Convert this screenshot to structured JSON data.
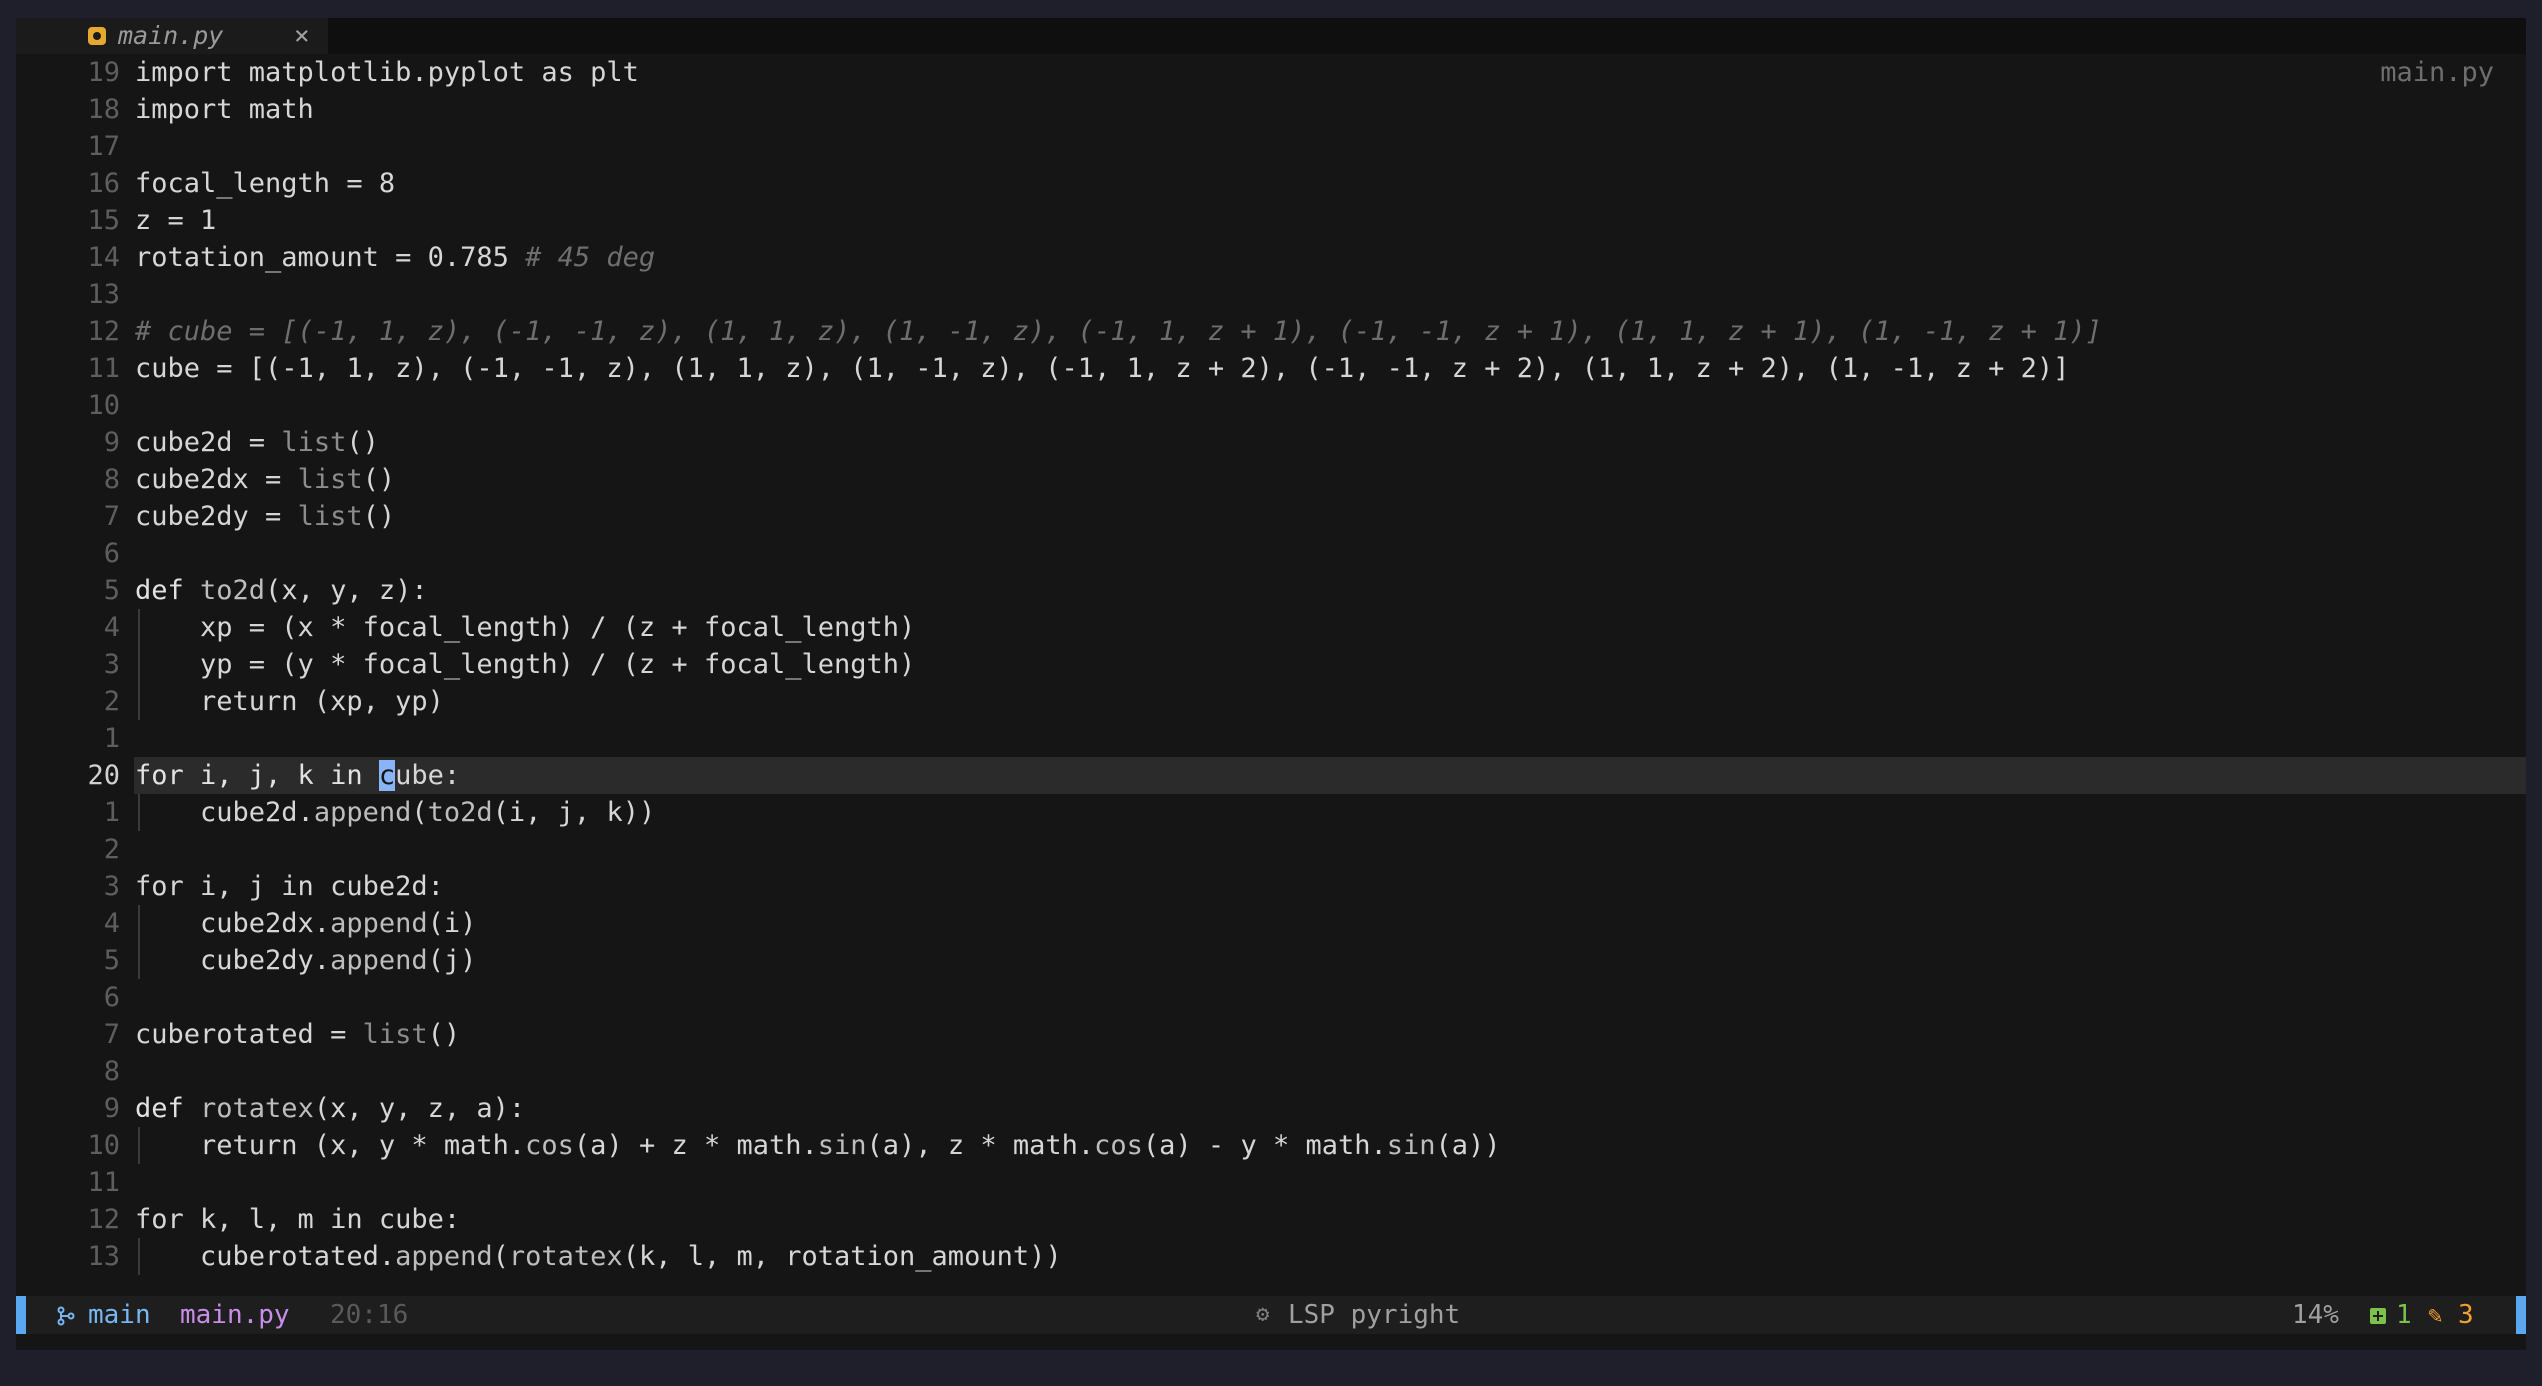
{
  "tab": {
    "label": "main.py",
    "close": "×"
  },
  "file_badge": "main.py",
  "lines": [
    {
      "num": "19",
      "segments": [
        {
          "t": "import matplotlib.pyplot as plt",
          "c": ""
        }
      ]
    },
    {
      "num": "18",
      "segments": [
        {
          "t": "import math",
          "c": ""
        }
      ]
    },
    {
      "num": "17",
      "segments": []
    },
    {
      "num": "16",
      "segments": [
        {
          "t": "focal_length = 8",
          "c": ""
        }
      ]
    },
    {
      "num": "15",
      "segments": [
        {
          "t": "z = 1",
          "c": ""
        }
      ]
    },
    {
      "num": "14",
      "segments": [
        {
          "t": "rotation_amount = 0.785 ",
          "c": ""
        },
        {
          "t": "# 45 deg",
          "c": "cm"
        }
      ]
    },
    {
      "num": "13",
      "segments": []
    },
    {
      "num": "12",
      "segments": [
        {
          "t": "# cube = [(-1, 1, z), (-1, -1, z), (1, 1, z), (1, -1, z), (-1, 1, z + 1), (-1, -1, z + 1), (1, 1, z + 1), (1, -1, z + 1)]",
          "c": "cm"
        }
      ]
    },
    {
      "num": "11",
      "segments": [
        {
          "t": "cube = [(-1, 1, z), (-1, -1, z), (1, 1, z), (1, -1, z), (-1, 1, z + 2), (-1, -1, z + 2), (1, 1, z + 2), (1, -1, z + 2)]",
          "c": ""
        }
      ]
    },
    {
      "num": "10",
      "segments": []
    },
    {
      "num": "9",
      "segments": [
        {
          "t": "cube2d = ",
          "c": ""
        },
        {
          "t": "list",
          "c": "bi"
        },
        {
          "t": "()",
          "c": ""
        }
      ]
    },
    {
      "num": "8",
      "segments": [
        {
          "t": "cube2dx = ",
          "c": ""
        },
        {
          "t": "list",
          "c": "bi"
        },
        {
          "t": "()",
          "c": ""
        }
      ]
    },
    {
      "num": "7",
      "segments": [
        {
          "t": "cube2dy = ",
          "c": ""
        },
        {
          "t": "list",
          "c": "bi"
        },
        {
          "t": "()",
          "c": ""
        }
      ]
    },
    {
      "num": "6",
      "segments": []
    },
    {
      "num": "5",
      "segments": [
        {
          "t": "def ",
          "c": "kw"
        },
        {
          "t": "to2d",
          "c": "fn"
        },
        {
          "t": "(x, y, z):",
          "c": ""
        }
      ]
    },
    {
      "num": "4",
      "indent": true,
      "segments": [
        {
          "t": "    xp = (x * focal_length) / (z + focal_length)",
          "c": ""
        }
      ]
    },
    {
      "num": "3",
      "indent": true,
      "segments": [
        {
          "t": "    yp = (y * focal_length) / (z + focal_length)",
          "c": ""
        }
      ]
    },
    {
      "num": "2",
      "indent": true,
      "segments": [
        {
          "t": "    return (xp, yp)",
          "c": ""
        }
      ]
    },
    {
      "num": "1",
      "segments": []
    },
    {
      "num": "20",
      "current": true,
      "segments": [
        {
          "t": "for i, j, k in ",
          "c": "kw"
        },
        {
          "t": "c",
          "c": "cursor"
        },
        {
          "t": "ube:",
          "c": ""
        }
      ]
    },
    {
      "num": "1",
      "indent": true,
      "segments": [
        {
          "t": "    cube2d.",
          "c": ""
        },
        {
          "t": "append",
          "c": "fn"
        },
        {
          "t": "(",
          "c": ""
        },
        {
          "t": "to2d",
          "c": "fn"
        },
        {
          "t": "(i, j, k))",
          "c": ""
        }
      ]
    },
    {
      "num": "2",
      "segments": []
    },
    {
      "num": "3",
      "segments": [
        {
          "t": "for i, j in cube2d:",
          "c": ""
        }
      ]
    },
    {
      "num": "4",
      "indent": true,
      "segments": [
        {
          "t": "    cube2dx.",
          "c": ""
        },
        {
          "t": "append",
          "c": "fn"
        },
        {
          "t": "(i)",
          "c": ""
        }
      ]
    },
    {
      "num": "5",
      "indent": true,
      "segments": [
        {
          "t": "    cube2dy.",
          "c": ""
        },
        {
          "t": "append",
          "c": "fn"
        },
        {
          "t": "(j)",
          "c": ""
        }
      ]
    },
    {
      "num": "6",
      "segments": []
    },
    {
      "num": "7",
      "segments": [
        {
          "t": "cuberotated = ",
          "c": ""
        },
        {
          "t": "list",
          "c": "bi"
        },
        {
          "t": "()",
          "c": ""
        }
      ]
    },
    {
      "num": "8",
      "segments": []
    },
    {
      "num": "9",
      "segments": [
        {
          "t": "def ",
          "c": "kw"
        },
        {
          "t": "rotatex",
          "c": "fn"
        },
        {
          "t": "(x, y, z, a):",
          "c": ""
        }
      ]
    },
    {
      "num": "10",
      "indent": true,
      "segments": [
        {
          "t": "    return (x, y * math.",
          "c": ""
        },
        {
          "t": "cos",
          "c": "fn"
        },
        {
          "t": "(a) + z * math.",
          "c": ""
        },
        {
          "t": "sin",
          "c": "fn"
        },
        {
          "t": "(a), z * math.",
          "c": ""
        },
        {
          "t": "cos",
          "c": "fn"
        },
        {
          "t": "(a) - y * math.",
          "c": ""
        },
        {
          "t": "sin",
          "c": "fn"
        },
        {
          "t": "(a))",
          "c": ""
        }
      ]
    },
    {
      "num": "11",
      "segments": []
    },
    {
      "num": "12",
      "segments": [
        {
          "t": "for k, l, m in cube:",
          "c": ""
        }
      ]
    },
    {
      "num": "13",
      "indent": true,
      "segments": [
        {
          "t": "    cuberotated.",
          "c": ""
        },
        {
          "t": "append",
          "c": "fn"
        },
        {
          "t": "(",
          "c": ""
        },
        {
          "t": "rotatex",
          "c": "fn"
        },
        {
          "t": "(k, l, m, rotation_amount))",
          "c": ""
        }
      ]
    }
  ],
  "statusbar": {
    "branch": "main",
    "file": "main.py",
    "position": "20:16",
    "lsp_icon": "⚙",
    "lsp": "LSP pyright",
    "percent": "14%",
    "added": "1",
    "modified_icon": "✎",
    "modified": "3"
  }
}
